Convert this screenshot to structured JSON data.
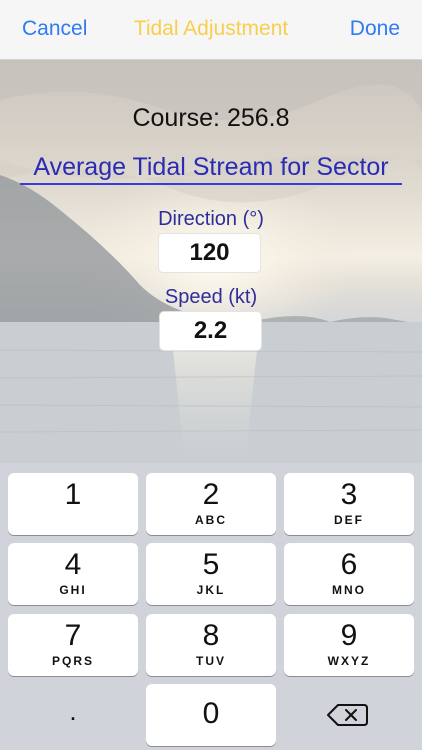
{
  "navbar": {
    "cancel_label": "Cancel",
    "title": "Tidal Adjustment",
    "done_label": "Done"
  },
  "main": {
    "course_text": "Course: 256.8",
    "sector_title": "Average Tidal Stream for Sector",
    "direction_label": "Direction (°)",
    "direction_value": "120",
    "speed_label": "Speed (kt)",
    "speed_value": "2.2"
  },
  "keypad": {
    "keys": [
      {
        "digit": "1",
        "letters": ""
      },
      {
        "digit": "2",
        "letters": "ABC"
      },
      {
        "digit": "3",
        "letters": "DEF"
      },
      {
        "digit": "4",
        "letters": "GHI"
      },
      {
        "digit": "5",
        "letters": "JKL"
      },
      {
        "digit": "6",
        "letters": "MNO"
      },
      {
        "digit": "7",
        "letters": "PQRS"
      },
      {
        "digit": "8",
        "letters": "TUV"
      },
      {
        "digit": "9",
        "letters": "WXYZ"
      },
      {
        "digit": ".",
        "letters": ""
      },
      {
        "digit": "0",
        "letters": ""
      }
    ],
    "delete_icon": "backspace-icon"
  },
  "colors": {
    "accent": "#2f7bf5",
    "title": "#f7cf4c",
    "sector_title": "#2b2bb4",
    "field_label": "#2d2d9c"
  }
}
